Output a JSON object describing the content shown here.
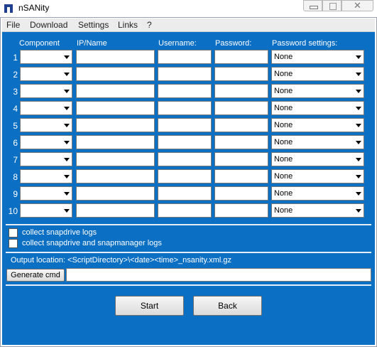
{
  "window": {
    "title": "nSANity",
    "close_glyph": "✕"
  },
  "menu": [
    "File",
    "Download",
    "Settings",
    "Links",
    "?"
  ],
  "headers": {
    "component": "Component",
    "ip_name": "IP/Name",
    "username": "Username:",
    "password": "Password:",
    "password_settings": "Password settings:"
  },
  "rows": [
    {
      "num": "1",
      "component": "",
      "ip_name": "",
      "username": "",
      "password": "",
      "password_setting": "None"
    },
    {
      "num": "2",
      "component": "",
      "ip_name": "",
      "username": "",
      "password": "",
      "password_setting": "None"
    },
    {
      "num": "3",
      "component": "",
      "ip_name": "",
      "username": "",
      "password": "",
      "password_setting": "None"
    },
    {
      "num": "4",
      "component": "",
      "ip_name": "",
      "username": "",
      "password": "",
      "password_setting": "None"
    },
    {
      "num": "5",
      "component": "",
      "ip_name": "",
      "username": "",
      "password": "",
      "password_setting": "None"
    },
    {
      "num": "6",
      "component": "",
      "ip_name": "",
      "username": "",
      "password": "",
      "password_setting": "None"
    },
    {
      "num": "7",
      "component": "",
      "ip_name": "",
      "username": "",
      "password": "",
      "password_setting": "None"
    },
    {
      "num": "8",
      "component": "",
      "ip_name": "",
      "username": "",
      "password": "",
      "password_setting": "None"
    },
    {
      "num": "9",
      "component": "",
      "ip_name": "",
      "username": "",
      "password": "",
      "password_setting": "None"
    },
    {
      "num": "10",
      "component": "",
      "ip_name": "",
      "username": "",
      "password": "",
      "password_setting": "None"
    }
  ],
  "options": {
    "collect_snapdrive": {
      "label": "collect snapdrive logs",
      "checked": false
    },
    "collect_snapdrive_snapmanager": {
      "label": "collect snapdrive and snapmanager logs",
      "checked": false
    }
  },
  "output": {
    "location_label": "Output location: <ScriptDirectory>\\<date><time>_nsanity.xml.gz",
    "generate_label": "Generate cmd",
    "command_value": ""
  },
  "actions": {
    "start_label": "Start",
    "back_label": "Back"
  },
  "colors": {
    "panel": "#0b6fc4",
    "menubar": "#ececec"
  }
}
